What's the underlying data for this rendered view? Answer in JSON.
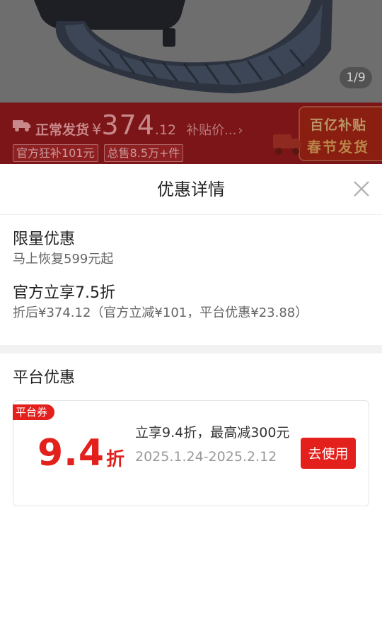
{
  "product": {
    "image_icon": "nylon-watch-band-image",
    "image_counter": "1/9"
  },
  "price_banner": {
    "ship_label": "正常发货",
    "currency": "¥",
    "price_integer": "374",
    "price_decimal": ".12",
    "subsidy_link": "补贴价...",
    "tags": [
      "官方狂补101元",
      "总售8.5万+件"
    ],
    "promo_line1": "百亿补贴",
    "promo_line2": "春节发货"
  },
  "sheet": {
    "title": "优惠详情",
    "close_icon": "close-icon",
    "discounts": [
      {
        "title": "限量优惠",
        "desc": "马上恢复599元起"
      },
      {
        "title": "官方立享7.5折",
        "desc": "折后¥374.12（官方立减¥101，平台优惠¥23.88）"
      }
    ],
    "platform_section_title": "平台优惠",
    "coupon": {
      "badge": "平台券",
      "rate": "9.4",
      "rate_unit": "折",
      "desc": "立享9.4折，最高减300元",
      "date_range": "2025.1.24-2025.2.12",
      "button_label": "去使用"
    }
  },
  "colors": {
    "accent_red": "#e3201c",
    "overlay_dim": "#6f6f6f"
  }
}
